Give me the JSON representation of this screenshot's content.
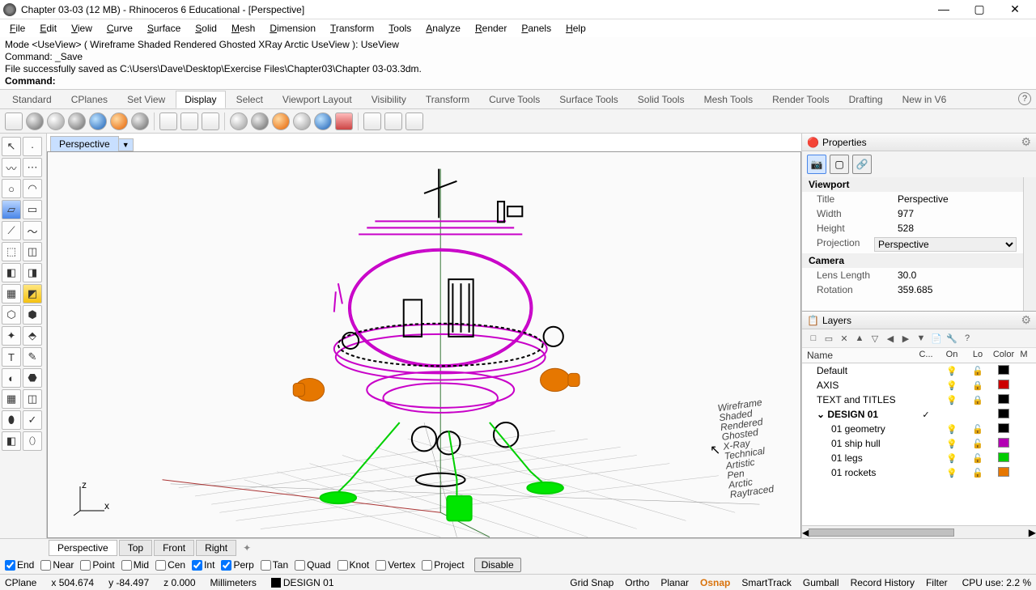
{
  "titlebar": {
    "text": "Chapter 03-03 (12 MB) - Rhinoceros 6 Educational - [Perspective]"
  },
  "menus": [
    "File",
    "Edit",
    "View",
    "Curve",
    "Surface",
    "Solid",
    "Mesh",
    "Dimension",
    "Transform",
    "Tools",
    "Analyze",
    "Render",
    "Panels",
    "Help"
  ],
  "command": {
    "line1": "Mode <UseView> ( Wireframe Shaded Rendered Ghosted XRay Arctic UseView ): UseView",
    "line2": "Command: _Save",
    "line3": "File successfully saved as C:\\Users\\Dave\\Desktop\\Exercise Files\\Chapter03\\Chapter 03-03.3dm.",
    "prompt": "Command:"
  },
  "tabs": [
    "Standard",
    "CPlanes",
    "Set View",
    "Display",
    "Select",
    "Viewport Layout",
    "Visibility",
    "Transform",
    "Curve Tools",
    "Surface Tools",
    "Solid Tools",
    "Mesh Tools",
    "Render Tools",
    "Drafting",
    "New in V6"
  ],
  "active_tab": "Display",
  "viewport_tab": "Perspective",
  "mode_labels": [
    "Wireframe",
    "Shaded",
    "Rendered",
    "Ghosted",
    "X-Ray",
    "Technical",
    "Artistic",
    "Pen",
    "Arctic",
    "Raytraced"
  ],
  "properties": {
    "title": "Properties",
    "viewport_section": "Viewport",
    "rows": {
      "title_lbl": "Title",
      "title_val": "Perspective",
      "width_lbl": "Width",
      "width_val": "977",
      "height_lbl": "Height",
      "height_val": "528",
      "proj_lbl": "Projection",
      "proj_val": "Perspective"
    },
    "camera_section": "Camera",
    "camera_rows": {
      "lens_lbl": "Lens Length",
      "lens_val": "30.0",
      "rot_lbl": "Rotation",
      "rot_val": "359.685"
    }
  },
  "layers": {
    "title": "Layers",
    "cols": {
      "name": "Name",
      "c": "C...",
      "on": "On",
      "lo": "Lo",
      "color": "Color",
      "m": "M"
    },
    "rows": [
      {
        "name": "Default",
        "indent": 0,
        "on": true,
        "lock": "open",
        "color": "#000000"
      },
      {
        "name": "AXIS",
        "indent": 0,
        "on": true,
        "lock": "locked",
        "color": "#cc0000"
      },
      {
        "name": "TEXT and TITLES",
        "indent": 0,
        "on": true,
        "lock": "locked",
        "color": "#000000"
      },
      {
        "name": "DESIGN 01",
        "indent": 0,
        "bold": true,
        "current": true,
        "color": "#000000",
        "expand": "open"
      },
      {
        "name": "01 geometry",
        "indent": 1,
        "on": true,
        "lock": "open",
        "color": "#000000"
      },
      {
        "name": "01 ship hull",
        "indent": 1,
        "on": true,
        "lock": "open",
        "color": "#b300b3"
      },
      {
        "name": "01 legs",
        "indent": 1,
        "on": true,
        "lock": "open",
        "color": "#00cc00"
      },
      {
        "name": "01 rockets",
        "indent": 1,
        "on": true,
        "lock": "open",
        "color": "#e67700"
      }
    ]
  },
  "bottom_tabs": [
    "Perspective",
    "Top",
    "Front",
    "Right"
  ],
  "osnaps": [
    {
      "label": "End",
      "checked": true
    },
    {
      "label": "Near",
      "checked": false
    },
    {
      "label": "Point",
      "checked": false
    },
    {
      "label": "Mid",
      "checked": false
    },
    {
      "label": "Cen",
      "checked": false
    },
    {
      "label": "Int",
      "checked": true
    },
    {
      "label": "Perp",
      "checked": true
    },
    {
      "label": "Tan",
      "checked": false
    },
    {
      "label": "Quad",
      "checked": false
    },
    {
      "label": "Knot",
      "checked": false
    },
    {
      "label": "Vertex",
      "checked": false
    },
    {
      "label": "Project",
      "checked": false
    }
  ],
  "disable_label": "Disable",
  "status": {
    "cplane": "CPlane",
    "x": "x 504.674",
    "y": "y -84.497",
    "z": "z 0.000",
    "units": "Millimeters",
    "layer": "DESIGN 01",
    "toggles": [
      "Grid Snap",
      "Ortho",
      "Planar",
      "Osnap",
      "SmartTrack",
      "Gumball",
      "Record History",
      "Filter"
    ],
    "cpu": "CPU use: 2.2 %"
  }
}
